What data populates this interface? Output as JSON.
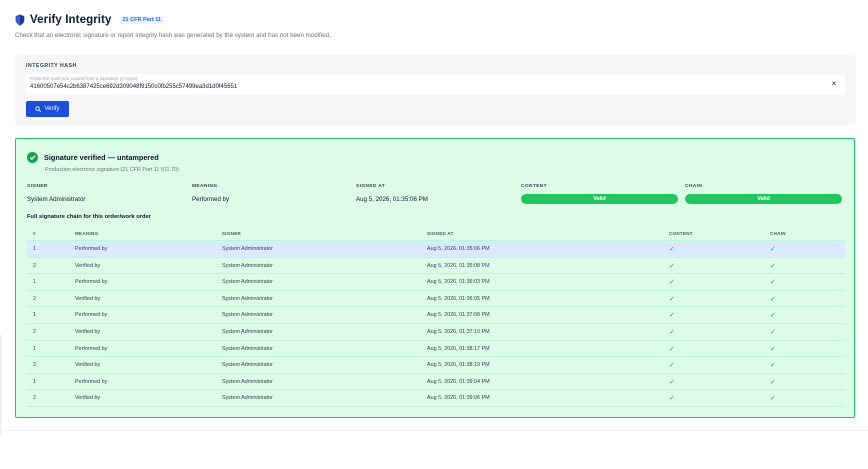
{
  "header": {
    "title": "Verify Integrity",
    "badge": "21 CFR Part 11",
    "subtitle": "Check that an electronic signature or report integrity hash was generated by the system and has not been modified."
  },
  "hash": {
    "label": "INTEGRITY HASH",
    "placeholder": "Paste the hash you copied from a signature or report",
    "value": "41600507e54c2b6387425ce692d309048f9150c0fb255c57499ea3d1d0f45651",
    "clear_symbol": "×",
    "verify_label": "Verify"
  },
  "result": {
    "status_title": "Signature verified — untampered",
    "status_sub": "Production electronic signature (21 CFR Part 11 §11.70)",
    "labels": {
      "signer": "SIGNER",
      "meaning": "MEANING",
      "signed_at": "SIGNED AT",
      "content": "CONTENT",
      "chain": "CHAIN"
    },
    "values": {
      "signer": "System Administrator",
      "meaning": "Performed by",
      "signed_at": "Aug 5, 2026, 01:35:06 PM",
      "content": "Valid",
      "chain": "Valid"
    },
    "chain_title": "Full signature chain for this order/work order"
  },
  "table": {
    "headers": [
      "#",
      "MEANING",
      "SIGNER",
      "SIGNED AT",
      "CONTENT",
      "CHAIN"
    ],
    "check_symbol": "✓",
    "rows": [
      {
        "n": "1",
        "meaning": "Performed by",
        "signer": "System Administrator",
        "signed_at": "Aug 5, 2026, 01:35:06 PM"
      },
      {
        "n": "2",
        "meaning": "Verified by",
        "signer": "System Administrator",
        "signed_at": "Aug 5, 2026, 01:35:08 PM"
      },
      {
        "n": "1",
        "meaning": "Performed by",
        "signer": "System Administrator",
        "signed_at": "Aug 5, 2026, 01:36:03 PM"
      },
      {
        "n": "2",
        "meaning": "Verified by",
        "signer": "System Administrator",
        "signed_at": "Aug 5, 2026, 01:36:05 PM"
      },
      {
        "n": "1",
        "meaning": "Performed by",
        "signer": "System Administrator",
        "signed_at": "Aug 5, 2026, 01:37:08 PM"
      },
      {
        "n": "2",
        "meaning": "Verified by",
        "signer": "System Administrator",
        "signed_at": "Aug 5, 2026, 01:37:10 PM"
      },
      {
        "n": "1",
        "meaning": "Performed by",
        "signer": "System Administrator",
        "signed_at": "Aug 5, 2026, 01:38:17 PM"
      },
      {
        "n": "2",
        "meaning": "Verified by",
        "signer": "System Administrator",
        "signed_at": "Aug 5, 2026, 01:38:19 PM"
      },
      {
        "n": "1",
        "meaning": "Performed by",
        "signer": "System Administrator",
        "signed_at": "Aug 5, 2026, 01:39:04 PM"
      },
      {
        "n": "2",
        "meaning": "Verified by",
        "signer": "System Administrator",
        "signed_at": "Aug 5, 2026, 01:39:06 PM"
      }
    ]
  },
  "colors": {
    "accent": "#1d4ed8",
    "success": "#22c55e",
    "success_bg": "#dcfce7",
    "highlight_row": "#dbeafe"
  }
}
